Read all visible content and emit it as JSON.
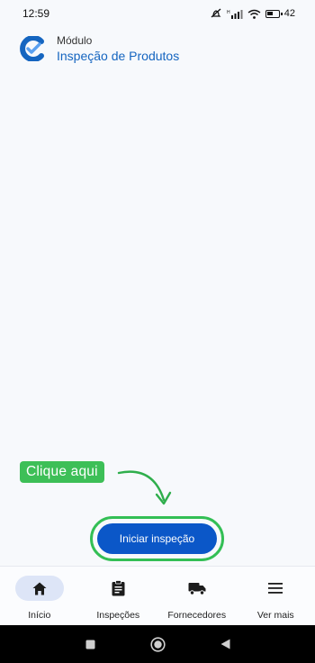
{
  "status_bar": {
    "time": "12:59",
    "signal_text": "H",
    "battery": "42"
  },
  "header": {
    "module_label": "Módulo",
    "module_name": "Inspeção de Produtos"
  },
  "callout": {
    "text": "Clique aqui"
  },
  "cta": {
    "label": "Iniciar inspeção"
  },
  "bottom_nav": {
    "items": [
      {
        "label": "Início",
        "icon": "home-icon",
        "active": true
      },
      {
        "label": "Inspeções",
        "icon": "clipboard-icon",
        "active": false
      },
      {
        "label": "Fornecedores",
        "icon": "truck-icon",
        "active": false
      },
      {
        "label": "Ver mais",
        "icon": "menu-icon",
        "active": false
      }
    ]
  },
  "colors": {
    "accent": "#0b57c8",
    "title": "#1565c0",
    "highlight": "#3dbf57",
    "nav_active_bg": "#dde5f7"
  }
}
